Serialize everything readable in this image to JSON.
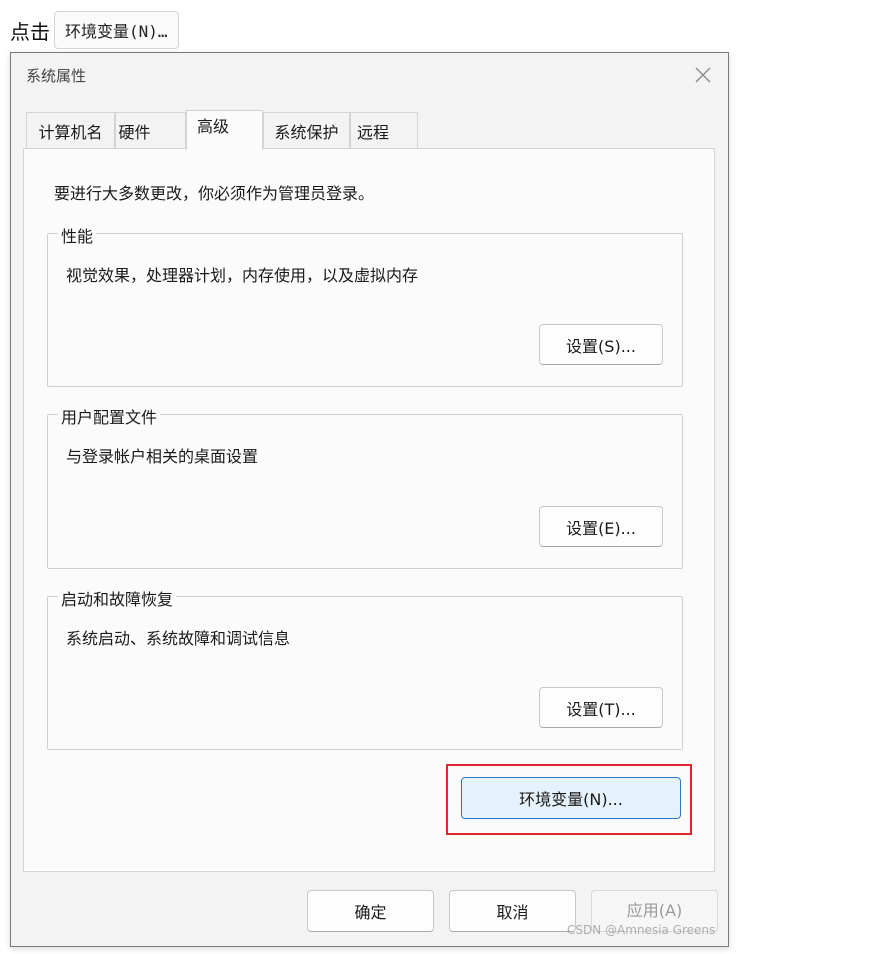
{
  "caption": {
    "prefix": "点击",
    "code": "环境变量(N)…"
  },
  "window": {
    "title": "系统属性",
    "close_icon": "close-icon"
  },
  "tabs": [
    {
      "label": "计算机名",
      "active": false
    },
    {
      "label": "硬件",
      "active": false
    },
    {
      "label": "高级",
      "active": true
    },
    {
      "label": "系统保护",
      "active": false
    },
    {
      "label": "远程",
      "active": false
    }
  ],
  "advanced": {
    "intro": "要进行大多数更改，你必须作为管理员登录。",
    "performance": {
      "legend": "性能",
      "description": "视觉效果，处理器计划，内存使用，以及虚拟内存",
      "button": "设置(S)..."
    },
    "profiles": {
      "legend": "用户配置文件",
      "description": "与登录帐户相关的桌面设置",
      "button": "设置(E)..."
    },
    "startup": {
      "legend": "启动和故障恢复",
      "description": "系统启动、系统故障和调试信息",
      "button": "设置(T)..."
    },
    "env_button": "环境变量(N)..."
  },
  "footer": {
    "ok": "确定",
    "cancel": "取消",
    "apply": "应用(A)"
  },
  "watermark": "CSDN @Amnesia Greens",
  "colors": {
    "highlight": "#e0262e",
    "primary_border": "#2f78c4",
    "primary_fill": "#e5f1fb"
  }
}
